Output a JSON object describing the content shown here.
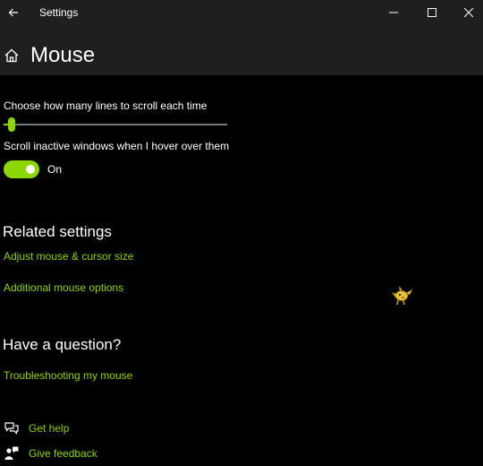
{
  "window": {
    "title": "Settings"
  },
  "page": {
    "title": "Mouse"
  },
  "scroll_lines": {
    "label": "Choose how many lines to scroll each time",
    "value": 3,
    "min": 1,
    "max": 100
  },
  "scroll_inactive": {
    "label": "Scroll inactive windows when I hover over them",
    "state": "On",
    "on": true
  },
  "related": {
    "title": "Related settings",
    "links": [
      "Adjust mouse & cursor size",
      "Additional mouse options"
    ]
  },
  "question": {
    "title": "Have a question?",
    "link": "Troubleshooting my mouse"
  },
  "help": {
    "get_help": "Get help",
    "give_feedback": "Give feedback"
  },
  "colors": {
    "accent": "#8cd700",
    "background": "#000000",
    "titlebar": "#1f1f1f"
  },
  "icons": {
    "back": "back-arrow-icon",
    "home": "home-icon",
    "get_help": "chat-bubbles-icon",
    "feedback": "feedback-person-icon"
  }
}
